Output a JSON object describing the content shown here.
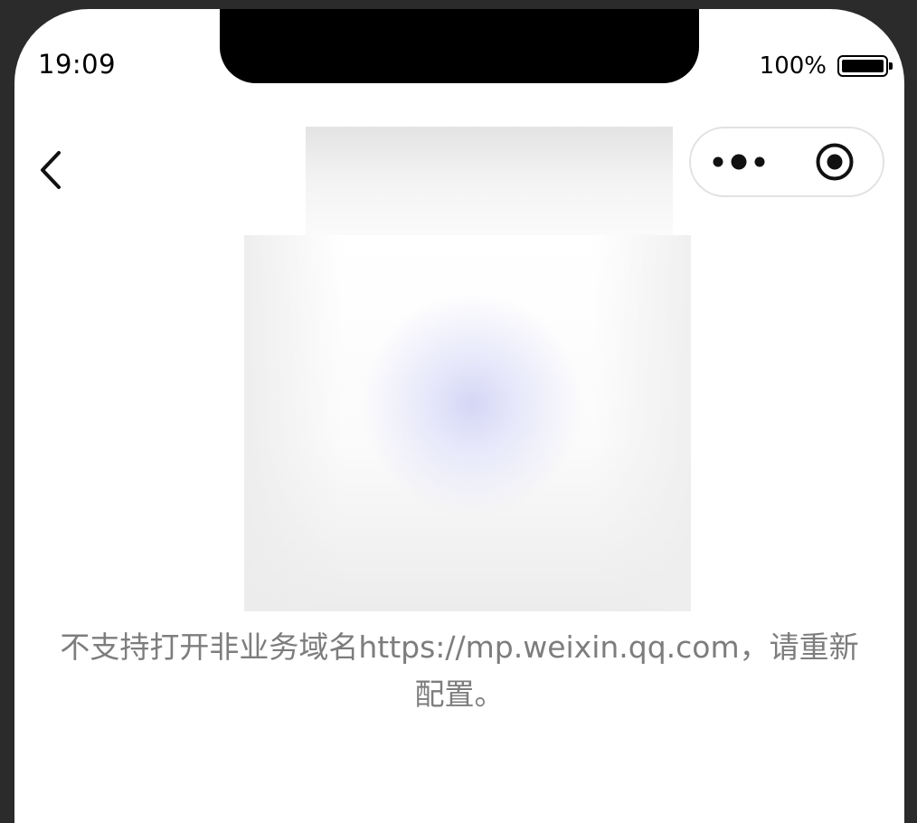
{
  "status_bar": {
    "time": "19:09",
    "battery_percent": "100%",
    "battery_level": 1.0
  },
  "nav": {
    "back_icon": "chevron-left-icon",
    "capsule": {
      "more_icon": "more-dots-icon",
      "close_icon": "record-circle-icon"
    }
  },
  "content": {
    "illustration_icon": "blurred-placeholder-image",
    "error_message": "不支持打开非业务域名https://mp.weixin.qq.com，请重新配置。"
  },
  "colors": {
    "background": "#ffffff",
    "frame": "#2b2b2b",
    "message_text": "#7d7d7d",
    "capsule_border": "#e2e2e2"
  }
}
